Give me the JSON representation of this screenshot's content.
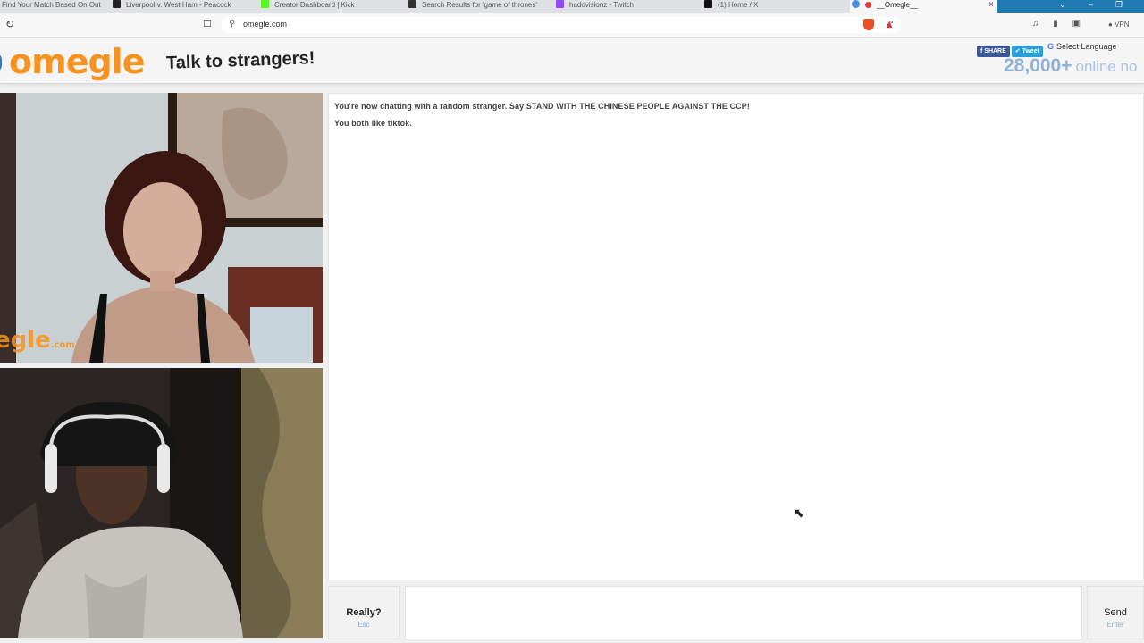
{
  "browser": {
    "tabs": [
      {
        "label": "Find Your Match Based On Out"
      },
      {
        "label": "Liverpool v. West Ham - Peacock"
      },
      {
        "label": "Creator Dashboard | Kick"
      },
      {
        "label": "Search Results for 'game of thrones'"
      },
      {
        "label": "hadovisionz - Twitch"
      },
      {
        "label": "(1) Home / X"
      },
      {
        "label": "__Omegle__"
      }
    ],
    "close_glyph": "×",
    "new_tab_glyph": "+",
    "url": "omegle.com",
    "vpn_label": "VPN"
  },
  "header": {
    "logo": "omegle",
    "tagline": "Talk to strangers!",
    "share_label": "SHARE",
    "tweet_label": "Tweet",
    "language_label": "Select Language",
    "online_count": "28,000+",
    "online_label": "online no"
  },
  "stranger_video": {
    "watermark": "egle",
    "watermark_suffix": ".com"
  },
  "chat": {
    "messages": [
      "You're now chatting with a random stranger. Say STAND WITH THE CHINESE PEOPLE AGAINST THE CCP!",
      "You both like tiktok."
    ]
  },
  "controls": {
    "stop_label": "Really?",
    "stop_key": "Esc",
    "send_label": "Send",
    "send_key": "Enter",
    "input_value": ""
  }
}
